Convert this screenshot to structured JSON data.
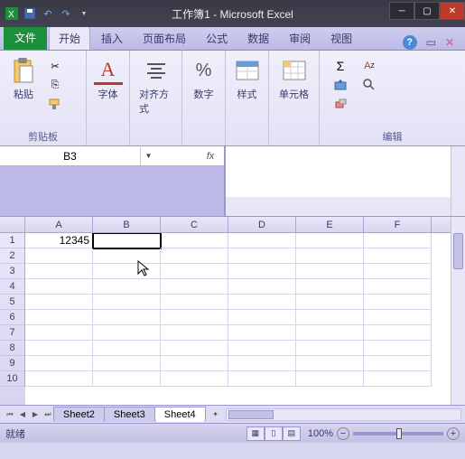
{
  "title": "工作簿1 - Microsoft Excel",
  "tabs": {
    "file": "文件",
    "home": "开始",
    "insert": "插入",
    "layout": "页面布局",
    "formulas": "公式",
    "data": "数据",
    "review": "审阅",
    "view": "视图"
  },
  "ribbon": {
    "clipboard": {
      "paste": "粘贴",
      "label": "剪贴板"
    },
    "font": {
      "btn": "字体"
    },
    "align": {
      "btn": "对齐方式"
    },
    "number": {
      "btn": "数字"
    },
    "styles": {
      "btn": "样式"
    },
    "cells": {
      "btn": "单元格"
    },
    "editing": {
      "label": "编辑"
    }
  },
  "namebox": "B3",
  "fx": "fx",
  "columns": [
    "A",
    "B",
    "C",
    "D",
    "E",
    "F"
  ],
  "rows": [
    "1",
    "2",
    "3",
    "4",
    "5",
    "6",
    "7",
    "8",
    "9",
    "10"
  ],
  "cells": {
    "A1": "12345"
  },
  "active_cell": "B1",
  "sheets": [
    "Sheet2",
    "Sheet3",
    "Sheet4"
  ],
  "status": "就绪",
  "zoom": "100%"
}
